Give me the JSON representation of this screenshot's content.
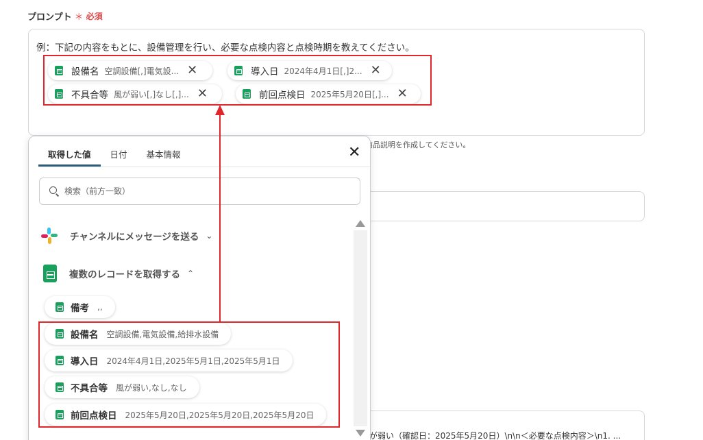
{
  "field": {
    "label": "プロンプト",
    "required_mark": "＊",
    "required_text": "必須"
  },
  "prompt": {
    "text": "例：下記の内容をもとに、設備管理を行い、必要な点検内容と点検時期を教えてください。",
    "chips": [
      {
        "name": "設備名",
        "value": "空調設備[,]電気設...",
        "close": "✕"
      },
      {
        "name": "導入日",
        "value": "2024年4月1日[,]2...",
        "close": "✕"
      },
      {
        "name": "不具合等",
        "value": "風が弱い[,]なし[,]...",
        "close": "✕"
      },
      {
        "name": "前回点検日",
        "value": "2025年5月20日[,]...",
        "close": "✕"
      }
    ]
  },
  "background": {
    "hint_text": "商品説明を作成してください。",
    "bottom_text": "が弱い（確認日：2025年5月20日）\\n\\n＜必要な点検内容＞\\n1. ..."
  },
  "popup": {
    "tabs": [
      {
        "label": "取得した値",
        "active": true
      },
      {
        "label": "日付",
        "active": false
      },
      {
        "label": "基本情報",
        "active": false
      }
    ],
    "close": "✕",
    "search_placeholder": "検索（前方一致）",
    "sections": [
      {
        "title": "チャンネルにメッセージを送る",
        "icon": "slack-icon",
        "chevron": "⌄"
      },
      {
        "title": "複数のレコードを取得する",
        "icon": "google-sheets-icon",
        "chevron": "⌃"
      }
    ],
    "items": [
      {
        "name": "備考",
        "value": ",,"
      },
      {
        "name": "設備名",
        "value": "空調設備,電気設備,給排水設備"
      },
      {
        "name": "導入日",
        "value": "2024年4月1日,2025年5月1日,2025年5月1日"
      },
      {
        "name": "不具合等",
        "value": "風が弱い,なし,なし"
      },
      {
        "name": "前回点検日",
        "value": "2025年5月20日,2025年5月20日,2025年5月20日"
      }
    ]
  },
  "colors": {
    "highlight": "#e0262b",
    "required": "#e04a4a",
    "sheets_green": "#19a05c",
    "tab_underline": "#2d5d79"
  }
}
